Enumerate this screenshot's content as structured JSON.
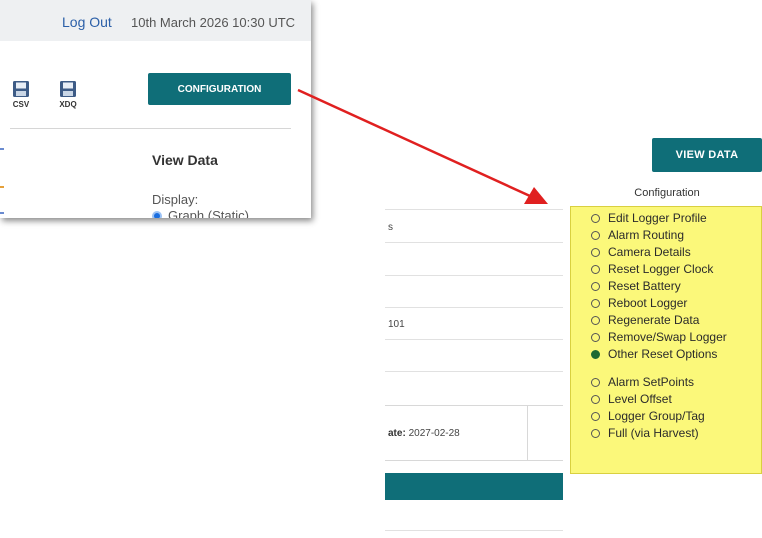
{
  "popup": {
    "logout": "Log Out",
    "datetime": "10th March 2026 10:30 UTC",
    "csv_label": "CSV",
    "xdq_label": "XDQ",
    "configuration_button": "CONFIGURATION",
    "view_data_heading": "View Data",
    "display_label": "Display:",
    "graph_static_option": "Graph (Static)"
  },
  "page": {
    "view_data_button": "VIEW DATA",
    "configuration_title": "Configuration",
    "row_fragments": [
      "s",
      "101"
    ],
    "date_label": "ate:",
    "date_value": "2027-02-28"
  },
  "configuration_menu": {
    "group1": [
      {
        "label": "Edit Logger Profile",
        "selected": false
      },
      {
        "label": "Alarm Routing",
        "selected": false
      },
      {
        "label": "Camera Details",
        "selected": false
      },
      {
        "label": "Reset Logger Clock",
        "selected": false
      },
      {
        "label": "Reset Battery",
        "selected": false
      },
      {
        "label": "Reboot Logger",
        "selected": false
      },
      {
        "label": "Regenerate Data",
        "selected": false
      },
      {
        "label": "Remove/Swap Logger",
        "selected": false
      },
      {
        "label": "Other Reset Options",
        "selected": true
      }
    ],
    "group2": [
      {
        "label": "Alarm SetPoints",
        "selected": false
      },
      {
        "label": "Level Offset",
        "selected": false
      },
      {
        "label": "Logger Group/Tag",
        "selected": false
      },
      {
        "label": "Full (via Harvest)",
        "selected": false
      }
    ]
  },
  "colors": {
    "teal": "#0f6e78",
    "highlight_yellow": "#fbf87a",
    "arrow_red": "#e02020",
    "selected_radio": "#1f6b32"
  },
  "icons": [
    "csv-save-icon",
    "xdq-save-icon",
    "red-arrow-icon"
  ]
}
